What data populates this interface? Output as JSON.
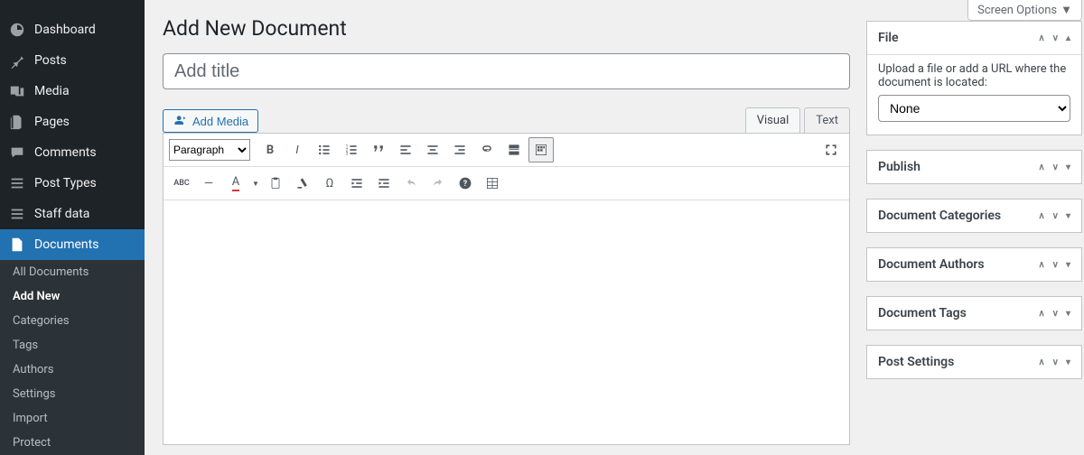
{
  "screen_options_label": "Screen Options",
  "page_title": "Add New Document",
  "title_placeholder": "Add title",
  "add_media_label": "Add Media",
  "tabs": {
    "visual": "Visual",
    "text": "Text"
  },
  "format_select": "Paragraph",
  "sidebar": {
    "items": [
      {
        "label": "Dashboard",
        "icon": "dashboard"
      },
      {
        "label": "Posts",
        "icon": "pin"
      },
      {
        "label": "Media",
        "icon": "media"
      },
      {
        "label": "Pages",
        "icon": "pages"
      },
      {
        "label": "Comments",
        "icon": "comments"
      },
      {
        "label": "Post Types",
        "icon": "posttypes"
      },
      {
        "label": "Staff data",
        "icon": "staff"
      },
      {
        "label": "Documents",
        "icon": "documents"
      }
    ],
    "submenu": [
      "All Documents",
      "Add New",
      "Categories",
      "Tags",
      "Authors",
      "Settings",
      "Import",
      "Protect"
    ],
    "submenu_active": "Add New"
  },
  "file_box": {
    "title": "File",
    "desc": "Upload a file or add a URL where the document is located:",
    "select_value": "None"
  },
  "meta_boxes": [
    {
      "title": "Publish"
    },
    {
      "title": "Document Categories"
    },
    {
      "title": "Document Authors"
    },
    {
      "title": "Document Tags"
    },
    {
      "title": "Post Settings"
    }
  ]
}
